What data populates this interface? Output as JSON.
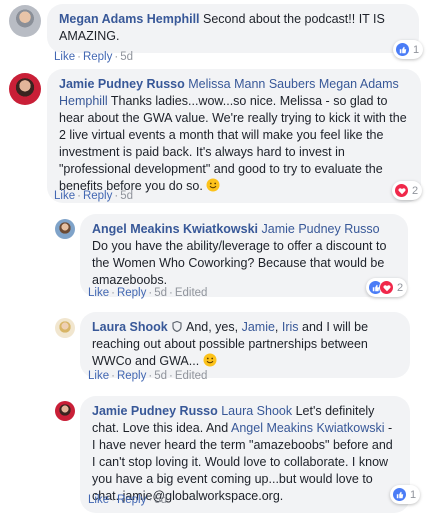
{
  "colors": {
    "link": "#385898",
    "action": "#4267b2",
    "meta": "#90949c",
    "bubble": "#f2f3f5",
    "like": "#4a7cf6",
    "love": "#f0284a"
  },
  "comments": [
    {
      "author": "Megan Adams Hemphill",
      "text": " Second about the podcast!! IT IS AMAZING.",
      "like": "Like",
      "reply": "Reply",
      "time": "5d",
      "reactions": {
        "icons": [
          "like-icon"
        ],
        "count": "1"
      }
    },
    {
      "author": "Jamie Pudney Russo",
      "tags": [
        "Melissa Mann Saubers",
        "Megan Adams Hemphill"
      ],
      "text": " Thanks ladies...wow...so nice. Melissa - so glad to hear about the GWA value. We're really trying to kick it with the 2 live virtual events a month that will make you feel like the investment is paid back. It's always hard to invest in \"professional development\" and good to try to evaluate the benefits before you do so. ",
      "like": "Like",
      "reply": "Reply",
      "time": "5d",
      "reactions": {
        "icons": [
          "love-icon"
        ],
        "count": "2"
      }
    },
    {
      "author": "Angel Meakins Kwiatkowski",
      "tags": [
        "Jamie Pudney Russo"
      ],
      "text": " Do you have the ability/leverage to offer a discount to the Women Who Coworking? Because that would be amazeboobs.",
      "like": "Like",
      "reply": "Reply",
      "time": "5d",
      "edited": "Edited",
      "reactions": {
        "icons": [
          "like-icon",
          "love-icon"
        ],
        "count": "2"
      }
    },
    {
      "author": "Laura Shook",
      "text_pre": " And, yes, ",
      "tags": [
        "Jamie",
        "Iris"
      ],
      "text_mid": ", ",
      "text_post": " and I will be reaching out about possible partnerships between WWCo and GWA... ",
      "like": "Like",
      "reply": "Reply",
      "time": "5d",
      "edited": "Edited"
    },
    {
      "author": "Jamie Pudney Russo",
      "tags": [
        "Laura Shook",
        "Angel Meakins Kwiatkowski"
      ],
      "text_pre": " Let's definitely chat. Love this idea. And ",
      "text_post": " - I have never heard the term \"amazeboobs\" before and I can't stop loving it. Would love to collaborate. I know you have a big event coming up...but would love to chat. jamie@globalworkspace.org.",
      "like": "Like",
      "reply": "Reply",
      "time": "5d",
      "reactions": {
        "icons": [
          "like-icon"
        ],
        "count": "1"
      }
    }
  ]
}
